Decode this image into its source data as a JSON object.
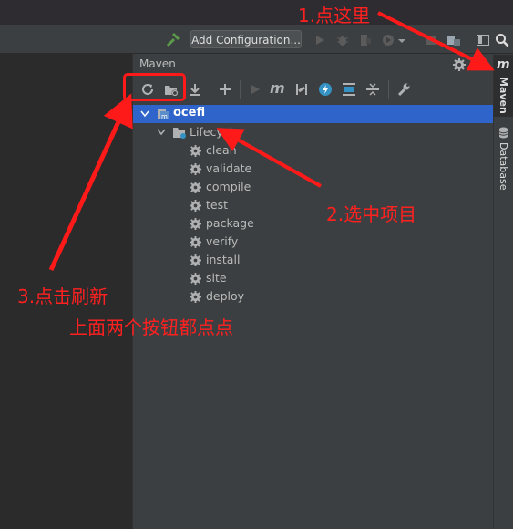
{
  "toolbar": {
    "run_config_label": "Add Configuration...",
    "icons": [
      "hammer-icon",
      "run-icon",
      "debug-icon",
      "coverage-icon",
      "profile-icon",
      "dropdown-icon",
      "stop-icon",
      "project-structure-icon",
      "terminal-icon",
      "search-icon"
    ]
  },
  "maven_panel": {
    "title": "Maven",
    "toolbar_icons": [
      "reload-icon",
      "reimport-folder-icon",
      "download-icon",
      "add-icon",
      "run-icon",
      "maven-m-icon",
      "skip-tests-icon",
      "offline-icon",
      "show-deps-icon",
      "collapse-icon",
      "settings-wrench-icon"
    ],
    "tree": {
      "project": "ocefi",
      "lifecycle_label": "Lifecycle",
      "goals": [
        "clean",
        "validate",
        "compile",
        "test",
        "package",
        "verify",
        "install",
        "site",
        "deploy"
      ]
    }
  },
  "side_tabs": {
    "maven_letter": "m",
    "maven": "Maven",
    "database": "Database"
  },
  "annotations": {
    "step1": "1.点这里",
    "step2": "2.选中项目",
    "step3_line1": "3.点击刷新",
    "step3_line2": "上面两个按钮都点点",
    "color": "#ff2020"
  }
}
